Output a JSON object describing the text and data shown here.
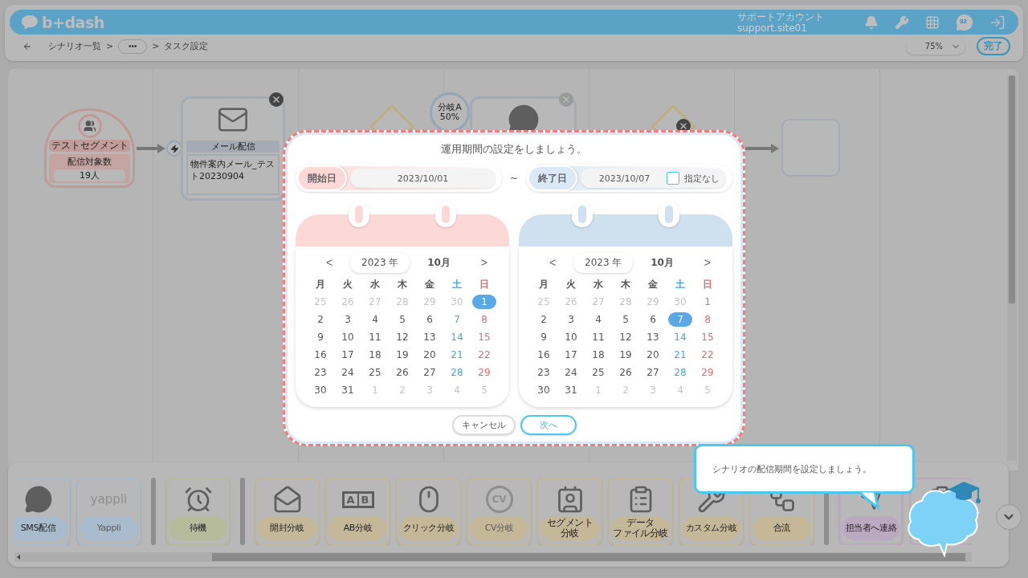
{
  "header": {
    "logo": "b+dash",
    "account_name": "サポートアカウント",
    "account_id": "support.site01",
    "chat_count": "32"
  },
  "breadcrumb": [
    {
      "kind": "link",
      "label": "シナリオ一覧"
    },
    {
      "kind": "sep",
      "label": ">"
    },
    {
      "kind": "more",
      "label": "•••"
    },
    {
      "kind": "sep",
      "label": ">"
    },
    {
      "kind": "current",
      "label": "タスク設定"
    }
  ],
  "zoom": {
    "value": "75%"
  },
  "done_button": "完了",
  "canvas": {
    "segment": {
      "label": "テストセグメント",
      "count_label": "配信対象数",
      "count": "19人"
    },
    "mail": {
      "title": "メール配信",
      "content": "物件案内メール_テスト20230904"
    },
    "branch": {
      "label": "分岐A",
      "ratio": "50%"
    }
  },
  "modal": {
    "title": "運用期間の設定をしましょう。",
    "start": {
      "label": "開始日",
      "value": "2023/10/01",
      "color": "#fcd9d6"
    },
    "range_separator": "~",
    "end": {
      "label": "終了日",
      "value": "2023/10/07",
      "color": "#dbe8f5",
      "no_end": {
        "label": "指定なし",
        "checked": false
      }
    },
    "calendars": [
      {
        "color": "#fcd9d6",
        "prev": "<",
        "year": "2023 年",
        "month": "10月",
        "next": ">",
        "weekdays": [
          "月",
          "火",
          "水",
          "木",
          "金",
          "土",
          "日"
        ],
        "days": [
          {
            "label": "25",
            "muted": true,
            "selected": false
          },
          {
            "label": "26",
            "muted": true,
            "selected": false
          },
          {
            "label": "27",
            "muted": true,
            "selected": false
          },
          {
            "label": "28",
            "muted": true,
            "selected": false
          },
          {
            "label": "29",
            "muted": true,
            "selected": false
          },
          {
            "label": "30",
            "muted": true,
            "selected": false
          },
          {
            "label": "1",
            "muted": false,
            "selected": true
          },
          {
            "label": "2",
            "muted": false,
            "selected": false
          },
          {
            "label": "3",
            "muted": false,
            "selected": false
          },
          {
            "label": "4",
            "muted": false,
            "selected": false
          },
          {
            "label": "5",
            "muted": false,
            "selected": false
          },
          {
            "label": "6",
            "muted": false,
            "selected": false
          },
          {
            "label": "7",
            "muted": false,
            "selected": false
          },
          {
            "label": "8",
            "muted": false,
            "selected": false
          },
          {
            "label": "9",
            "muted": false,
            "selected": false
          },
          {
            "label": "10",
            "muted": false,
            "selected": false
          },
          {
            "label": "11",
            "muted": false,
            "selected": false
          },
          {
            "label": "12",
            "muted": false,
            "selected": false
          },
          {
            "label": "13",
            "muted": false,
            "selected": false
          },
          {
            "label": "14",
            "muted": false,
            "selected": false
          },
          {
            "label": "15",
            "muted": false,
            "selected": false
          },
          {
            "label": "16",
            "muted": false,
            "selected": false
          },
          {
            "label": "17",
            "muted": false,
            "selected": false
          },
          {
            "label": "18",
            "muted": false,
            "selected": false
          },
          {
            "label": "19",
            "muted": false,
            "selected": false
          },
          {
            "label": "20",
            "muted": false,
            "selected": false
          },
          {
            "label": "21",
            "muted": false,
            "selected": false
          },
          {
            "label": "22",
            "muted": false,
            "selected": false
          },
          {
            "label": "23",
            "muted": false,
            "selected": false
          },
          {
            "label": "24",
            "muted": false,
            "selected": false
          },
          {
            "label": "25",
            "muted": false,
            "selected": false
          },
          {
            "label": "26",
            "muted": false,
            "selected": false
          },
          {
            "label": "27",
            "muted": false,
            "selected": false
          },
          {
            "label": "28",
            "muted": false,
            "selected": false
          },
          {
            "label": "29",
            "muted": false,
            "selected": false
          },
          {
            "label": "30",
            "muted": false,
            "selected": false
          },
          {
            "label": "31",
            "muted": false,
            "selected": false
          },
          {
            "label": "1",
            "muted": true,
            "selected": false
          },
          {
            "label": "2",
            "muted": true,
            "selected": false
          },
          {
            "label": "3",
            "muted": true,
            "selected": false
          },
          {
            "label": "4",
            "muted": true,
            "selected": false
          },
          {
            "label": "5",
            "muted": true,
            "selected": false
          }
        ]
      },
      {
        "color": "#cfe0ef",
        "prev": "<",
        "year": "2023 年",
        "month": "10月",
        "next": ">",
        "weekdays": [
          "月",
          "火",
          "水",
          "木",
          "金",
          "土",
          "日"
        ],
        "days": [
          {
            "label": "25",
            "muted": true,
            "selected": false
          },
          {
            "label": "26",
            "muted": true,
            "selected": false
          },
          {
            "label": "27",
            "muted": true,
            "selected": false
          },
          {
            "label": "28",
            "muted": true,
            "selected": false
          },
          {
            "label": "29",
            "muted": true,
            "selected": false
          },
          {
            "label": "30",
            "muted": true,
            "selected": false
          },
          {
            "label": "1",
            "muted": false,
            "selected": false
          },
          {
            "label": "2",
            "muted": false,
            "selected": false
          },
          {
            "label": "3",
            "muted": false,
            "selected": false
          },
          {
            "label": "4",
            "muted": false,
            "selected": false
          },
          {
            "label": "5",
            "muted": false,
            "selected": false
          },
          {
            "label": "6",
            "muted": false,
            "selected": false
          },
          {
            "label": "7",
            "muted": false,
            "selected": true
          },
          {
            "label": "8",
            "muted": false,
            "selected": false
          },
          {
            "label": "9",
            "muted": false,
            "selected": false
          },
          {
            "label": "10",
            "muted": false,
            "selected": false
          },
          {
            "label": "11",
            "muted": false,
            "selected": false
          },
          {
            "label": "12",
            "muted": false,
            "selected": false
          },
          {
            "label": "13",
            "muted": false,
            "selected": false
          },
          {
            "label": "14",
            "muted": false,
            "selected": false
          },
          {
            "label": "15",
            "muted": false,
            "selected": false
          },
          {
            "label": "16",
            "muted": false,
            "selected": false
          },
          {
            "label": "17",
            "muted": false,
            "selected": false
          },
          {
            "label": "18",
            "muted": false,
            "selected": false
          },
          {
            "label": "19",
            "muted": false,
            "selected": false
          },
          {
            "label": "20",
            "muted": false,
            "selected": false
          },
          {
            "label": "21",
            "muted": false,
            "selected": false
          },
          {
            "label": "22",
            "muted": false,
            "selected": false
          },
          {
            "label": "23",
            "muted": false,
            "selected": false
          },
          {
            "label": "24",
            "muted": false,
            "selected": false
          },
          {
            "label": "25",
            "muted": false,
            "selected": false
          },
          {
            "label": "26",
            "muted": false,
            "selected": false
          },
          {
            "label": "27",
            "muted": false,
            "selected": false
          },
          {
            "label": "28",
            "muted": false,
            "selected": false
          },
          {
            "label": "29",
            "muted": false,
            "selected": false
          },
          {
            "label": "30",
            "muted": false,
            "selected": false
          },
          {
            "label": "31",
            "muted": false,
            "selected": false
          },
          {
            "label": "1",
            "muted": true,
            "selected": false
          },
          {
            "label": "2",
            "muted": true,
            "selected": false
          },
          {
            "label": "3",
            "muted": true,
            "selected": false
          },
          {
            "label": "4",
            "muted": true,
            "selected": false
          },
          {
            "label": "5",
            "muted": true,
            "selected": false
          }
        ]
      }
    ],
    "buttons": [
      {
        "label": "キャンセル",
        "kind": "secondary"
      },
      {
        "label": "次へ",
        "kind": "primary"
      }
    ]
  },
  "palette": [
    {
      "kind": "tool",
      "label": [
        "SMS配信"
      ],
      "color": "#a9bccd",
      "disabled": false
    },
    {
      "kind": "tool",
      "logo_text": "yappli",
      "label": [
        "Yappli"
      ],
      "color": "#a9bccd",
      "disabled": true
    },
    {
      "kind": "separator"
    },
    {
      "kind": "tool",
      "label": [
        "待機"
      ],
      "color": "#b5bb9b",
      "disabled": false
    },
    {
      "kind": "separator"
    },
    {
      "kind": "tool",
      "label": [
        "開封分岐"
      ],
      "color": "#c4b898",
      "disabled": false
    },
    {
      "kind": "tool",
      "icon_text": [
        "A",
        "B"
      ],
      "label": [
        "AB分岐"
      ],
      "color": "#c4b898",
      "disabled": false
    },
    {
      "kind": "tool",
      "label": [
        "クリック分岐"
      ],
      "color": "#c4b898",
      "disabled": false
    },
    {
      "kind": "tool",
      "icon_text": [
        "CV"
      ],
      "label": [
        "CV分岐"
      ],
      "color": "#c4b898",
      "disabled": true
    },
    {
      "kind": "tool",
      "label": [
        "セグメント",
        "分岐"
      ],
      "color": "#c4b898",
      "disabled": false
    },
    {
      "kind": "tool",
      "label": [
        "データ",
        "ファイル分岐"
      ],
      "color": "#c4b898",
      "disabled": false
    },
    {
      "kind": "tool",
      "label": [
        "カスタム分岐"
      ],
      "color": "#c4b898",
      "disabled": false
    },
    {
      "kind": "tool",
      "label": [
        "合流"
      ],
      "color": "#c4b898",
      "disabled": false
    },
    {
      "kind": "separator"
    },
    {
      "kind": "tool",
      "label": [
        "担当者へ連絡"
      ],
      "color": "#bba9c1",
      "disabled": false
    },
    {
      "kind": "tool",
      "color": "#bba9c1"
    }
  ],
  "guide": {
    "message": "シナリオの配信期間を設定しましょう。"
  }
}
